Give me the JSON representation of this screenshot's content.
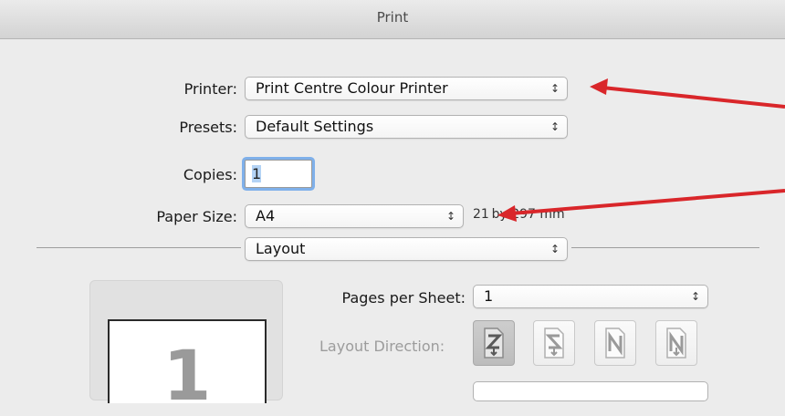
{
  "window": {
    "title": "Print"
  },
  "printer": {
    "label": "Printer:",
    "value": "Print Centre Colour Printer"
  },
  "presets": {
    "label": "Presets:",
    "value": "Default Settings"
  },
  "copies": {
    "label": "Copies:",
    "value": "1"
  },
  "paper_size": {
    "label": "Paper Size:",
    "value": "A4",
    "dimensions": "21 by 297 mm"
  },
  "section": {
    "value": "Layout"
  },
  "pages_per_sheet": {
    "label": "Pages per Sheet:",
    "value": "1"
  },
  "layout_direction": {
    "label": "Layout Direction:",
    "options": [
      "layout-direction-z-icon",
      "layout-direction-reverse-z-icon",
      "layout-direction-reverse-n-icon",
      "layout-direction-n-icon"
    ],
    "selected_index": 0
  },
  "preview": {
    "page_number": "1"
  },
  "annotation_color": "#d9262a"
}
